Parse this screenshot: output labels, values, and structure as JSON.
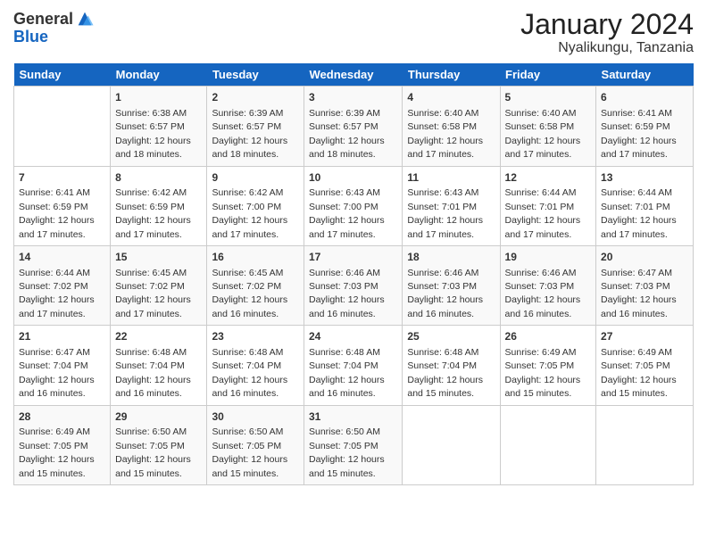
{
  "logo": {
    "general": "General",
    "blue": "Blue"
  },
  "header": {
    "month": "January 2024",
    "location": "Nyalikungu, Tanzania"
  },
  "columns": [
    "Sunday",
    "Monday",
    "Tuesday",
    "Wednesday",
    "Thursday",
    "Friday",
    "Saturday"
  ],
  "weeks": [
    [
      {
        "day": "",
        "info": ""
      },
      {
        "day": "1",
        "info": "Sunrise: 6:38 AM\nSunset: 6:57 PM\nDaylight: 12 hours\nand 18 minutes."
      },
      {
        "day": "2",
        "info": "Sunrise: 6:39 AM\nSunset: 6:57 PM\nDaylight: 12 hours\nand 18 minutes."
      },
      {
        "day": "3",
        "info": "Sunrise: 6:39 AM\nSunset: 6:57 PM\nDaylight: 12 hours\nand 18 minutes."
      },
      {
        "day": "4",
        "info": "Sunrise: 6:40 AM\nSunset: 6:58 PM\nDaylight: 12 hours\nand 17 minutes."
      },
      {
        "day": "5",
        "info": "Sunrise: 6:40 AM\nSunset: 6:58 PM\nDaylight: 12 hours\nand 17 minutes."
      },
      {
        "day": "6",
        "info": "Sunrise: 6:41 AM\nSunset: 6:59 PM\nDaylight: 12 hours\nand 17 minutes."
      }
    ],
    [
      {
        "day": "7",
        "info": "Sunrise: 6:41 AM\nSunset: 6:59 PM\nDaylight: 12 hours\nand 17 minutes."
      },
      {
        "day": "8",
        "info": "Sunrise: 6:42 AM\nSunset: 6:59 PM\nDaylight: 12 hours\nand 17 minutes."
      },
      {
        "day": "9",
        "info": "Sunrise: 6:42 AM\nSunset: 7:00 PM\nDaylight: 12 hours\nand 17 minutes."
      },
      {
        "day": "10",
        "info": "Sunrise: 6:43 AM\nSunset: 7:00 PM\nDaylight: 12 hours\nand 17 minutes."
      },
      {
        "day": "11",
        "info": "Sunrise: 6:43 AM\nSunset: 7:01 PM\nDaylight: 12 hours\nand 17 minutes."
      },
      {
        "day": "12",
        "info": "Sunrise: 6:44 AM\nSunset: 7:01 PM\nDaylight: 12 hours\nand 17 minutes."
      },
      {
        "day": "13",
        "info": "Sunrise: 6:44 AM\nSunset: 7:01 PM\nDaylight: 12 hours\nand 17 minutes."
      }
    ],
    [
      {
        "day": "14",
        "info": "Sunrise: 6:44 AM\nSunset: 7:02 PM\nDaylight: 12 hours\nand 17 minutes."
      },
      {
        "day": "15",
        "info": "Sunrise: 6:45 AM\nSunset: 7:02 PM\nDaylight: 12 hours\nand 17 minutes."
      },
      {
        "day": "16",
        "info": "Sunrise: 6:45 AM\nSunset: 7:02 PM\nDaylight: 12 hours\nand 16 minutes."
      },
      {
        "day": "17",
        "info": "Sunrise: 6:46 AM\nSunset: 7:03 PM\nDaylight: 12 hours\nand 16 minutes."
      },
      {
        "day": "18",
        "info": "Sunrise: 6:46 AM\nSunset: 7:03 PM\nDaylight: 12 hours\nand 16 minutes."
      },
      {
        "day": "19",
        "info": "Sunrise: 6:46 AM\nSunset: 7:03 PM\nDaylight: 12 hours\nand 16 minutes."
      },
      {
        "day": "20",
        "info": "Sunrise: 6:47 AM\nSunset: 7:03 PM\nDaylight: 12 hours\nand 16 minutes."
      }
    ],
    [
      {
        "day": "21",
        "info": "Sunrise: 6:47 AM\nSunset: 7:04 PM\nDaylight: 12 hours\nand 16 minutes."
      },
      {
        "day": "22",
        "info": "Sunrise: 6:48 AM\nSunset: 7:04 PM\nDaylight: 12 hours\nand 16 minutes."
      },
      {
        "day": "23",
        "info": "Sunrise: 6:48 AM\nSunset: 7:04 PM\nDaylight: 12 hours\nand 16 minutes."
      },
      {
        "day": "24",
        "info": "Sunrise: 6:48 AM\nSunset: 7:04 PM\nDaylight: 12 hours\nand 16 minutes."
      },
      {
        "day": "25",
        "info": "Sunrise: 6:48 AM\nSunset: 7:04 PM\nDaylight: 12 hours\nand 15 minutes."
      },
      {
        "day": "26",
        "info": "Sunrise: 6:49 AM\nSunset: 7:05 PM\nDaylight: 12 hours\nand 15 minutes."
      },
      {
        "day": "27",
        "info": "Sunrise: 6:49 AM\nSunset: 7:05 PM\nDaylight: 12 hours\nand 15 minutes."
      }
    ],
    [
      {
        "day": "28",
        "info": "Sunrise: 6:49 AM\nSunset: 7:05 PM\nDaylight: 12 hours\nand 15 minutes."
      },
      {
        "day": "29",
        "info": "Sunrise: 6:50 AM\nSunset: 7:05 PM\nDaylight: 12 hours\nand 15 minutes."
      },
      {
        "day": "30",
        "info": "Sunrise: 6:50 AM\nSunset: 7:05 PM\nDaylight: 12 hours\nand 15 minutes."
      },
      {
        "day": "31",
        "info": "Sunrise: 6:50 AM\nSunset: 7:05 PM\nDaylight: 12 hours\nand 15 minutes."
      },
      {
        "day": "",
        "info": ""
      },
      {
        "day": "",
        "info": ""
      },
      {
        "day": "",
        "info": ""
      }
    ]
  ]
}
